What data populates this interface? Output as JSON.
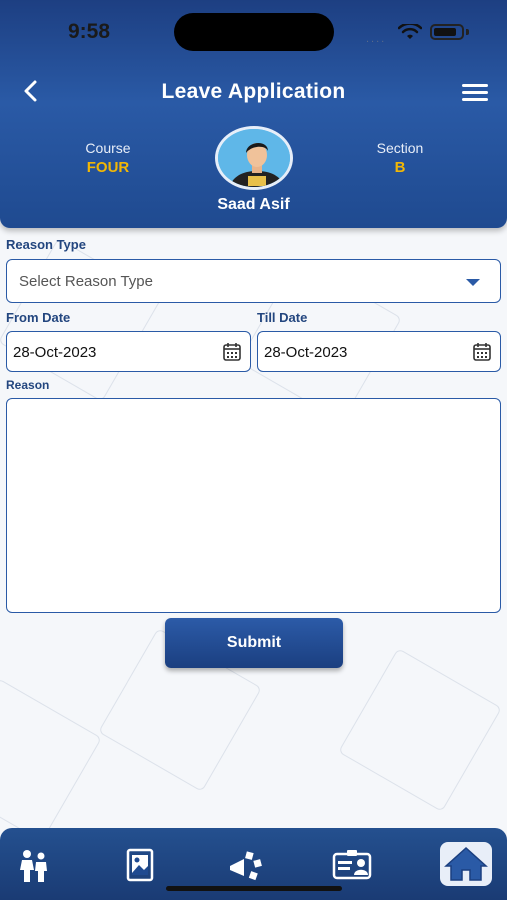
{
  "status_bar": {
    "time": "9:58",
    "signal": "...."
  },
  "nav": {
    "title": "Leave Application"
  },
  "profile": {
    "course_label": "Course",
    "course_value": "FOUR",
    "section_label": "Section",
    "section_value": "B",
    "name": "Saad Asif"
  },
  "form": {
    "reason_type_label": "Reason Type",
    "reason_type_placeholder": "Select Reason Type",
    "from_date_label": "From Date",
    "from_date_value": "28-Oct-2023",
    "till_date_label": "Till Date",
    "till_date_value": "28-Oct-2023",
    "reason_label": "Reason",
    "reason_value": "",
    "submit_label": "Submit"
  },
  "bottom_nav": {
    "items": [
      {
        "icon": "children-icon"
      },
      {
        "icon": "gallery-icon"
      },
      {
        "icon": "announcements-icon"
      },
      {
        "icon": "id-card-icon"
      },
      {
        "icon": "home-icon"
      }
    ]
  },
  "colors": {
    "primary": "#1f4a90",
    "accent": "#f2b705",
    "label": "#23467f"
  }
}
